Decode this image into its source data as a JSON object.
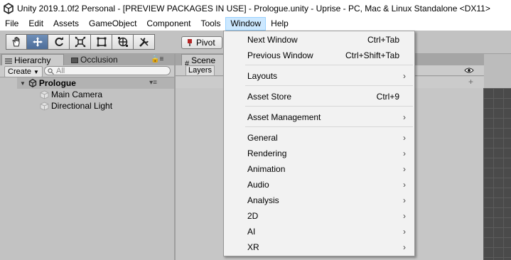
{
  "window": {
    "title": "Unity 2019.1.0f2 Personal - [PREVIEW PACKAGES IN USE] - Prologue.unity - Uprise - PC, Mac & Linux Standalone <DX11>"
  },
  "menubar": {
    "items": [
      "File",
      "Edit",
      "Assets",
      "GameObject",
      "Component",
      "Tools",
      "Window",
      "Help"
    ],
    "active": "Window"
  },
  "toolbar": {
    "tools": [
      "hand-tool",
      "move-tool",
      "rotate-tool",
      "scale-tool",
      "rect-tool",
      "transform-tool",
      "custom-tool"
    ],
    "selected_tool": "move-tool",
    "pivot_label": "Pivot"
  },
  "hierarchy": {
    "tab_label": "Hierarchy",
    "other_tab_label": "Occlusion",
    "create_label": "Create",
    "search_placeholder": "All",
    "scene_name": "Prologue",
    "objects": [
      "Main Camera",
      "Directional Light"
    ]
  },
  "scene": {
    "tab_label": "Scene",
    "layers_label": "Layers"
  },
  "window_menu": {
    "items": [
      {
        "label": "Next Window",
        "shortcut": "Ctrl+Tab",
        "submenu": false
      },
      {
        "label": "Previous Window",
        "shortcut": "Ctrl+Shift+Tab",
        "submenu": false
      },
      {
        "label": "Layouts",
        "shortcut": "",
        "submenu": true
      },
      {
        "label": "Asset Store",
        "shortcut": "Ctrl+9",
        "submenu": false
      },
      {
        "label": "Asset Management",
        "shortcut": "",
        "submenu": true
      },
      {
        "label": "General",
        "shortcut": "",
        "submenu": true
      },
      {
        "label": "Rendering",
        "shortcut": "",
        "submenu": true
      },
      {
        "label": "Animation",
        "shortcut": "",
        "submenu": true
      },
      {
        "label": "Audio",
        "shortcut": "",
        "submenu": true
      },
      {
        "label": "Analysis",
        "shortcut": "",
        "submenu": true
      },
      {
        "label": "2D",
        "shortcut": "",
        "submenu": true
      },
      {
        "label": "AI",
        "shortcut": "",
        "submenu": true
      },
      {
        "label": "XR",
        "shortcut": "",
        "submenu": true
      }
    ]
  },
  "colors": {
    "menu_highlight": "#cce8ff",
    "tool_selected": "#4d6d99"
  }
}
